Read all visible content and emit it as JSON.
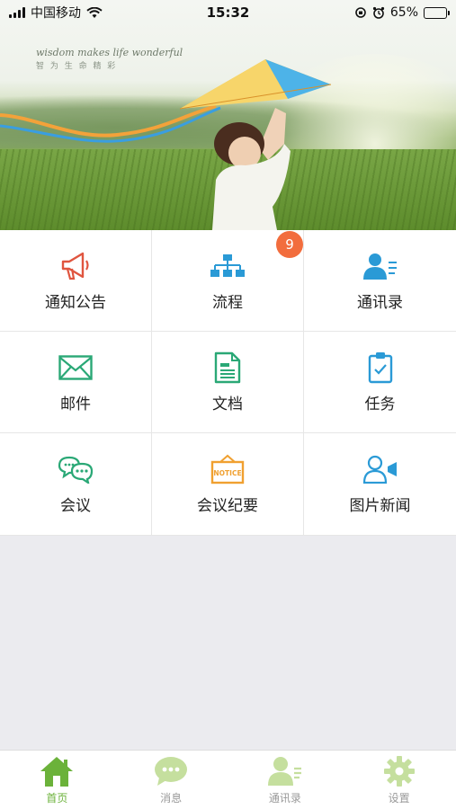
{
  "status_bar": {
    "carrier": "中国移动",
    "time": "15:32",
    "battery_percent": "65%",
    "battery_level": 0.65
  },
  "banner": {
    "slogan": "wisdom makes life wonderful",
    "slogan_cn": "智 为 生 命 精 彩"
  },
  "menu": {
    "items": [
      {
        "label": "通知公告",
        "icon": "megaphone-icon"
      },
      {
        "label": "流程",
        "icon": "flowchart-icon",
        "badge": "9"
      },
      {
        "label": "通讯录",
        "icon": "contacts-icon"
      },
      {
        "label": "邮件",
        "icon": "mail-icon"
      },
      {
        "label": "文档",
        "icon": "document-icon"
      },
      {
        "label": "任务",
        "icon": "clipboard-check-icon"
      },
      {
        "label": "会议",
        "icon": "chat-bubbles-icon"
      },
      {
        "label": "会议纪要",
        "icon": "notice-board-icon",
        "icon_text": "NOTICE"
      },
      {
        "label": "图片新闻",
        "icon": "video-user-icon"
      }
    ]
  },
  "tabbar": {
    "items": [
      {
        "label": "首页",
        "icon": "home-icon",
        "active": true
      },
      {
        "label": "消息",
        "icon": "message-icon",
        "active": false
      },
      {
        "label": "通讯录",
        "icon": "contacts-icon",
        "active": false
      },
      {
        "label": "设置",
        "icon": "gear-icon",
        "active": false
      }
    ]
  },
  "colors": {
    "accent_green": "#6bb23a",
    "inactive_green": "#c5df9e",
    "badge": "#f26d3d",
    "red_icon": "#e0553f",
    "blue_icon": "#2a9ad6",
    "teal_icon": "#2aa876",
    "orange_icon": "#f0a030"
  }
}
